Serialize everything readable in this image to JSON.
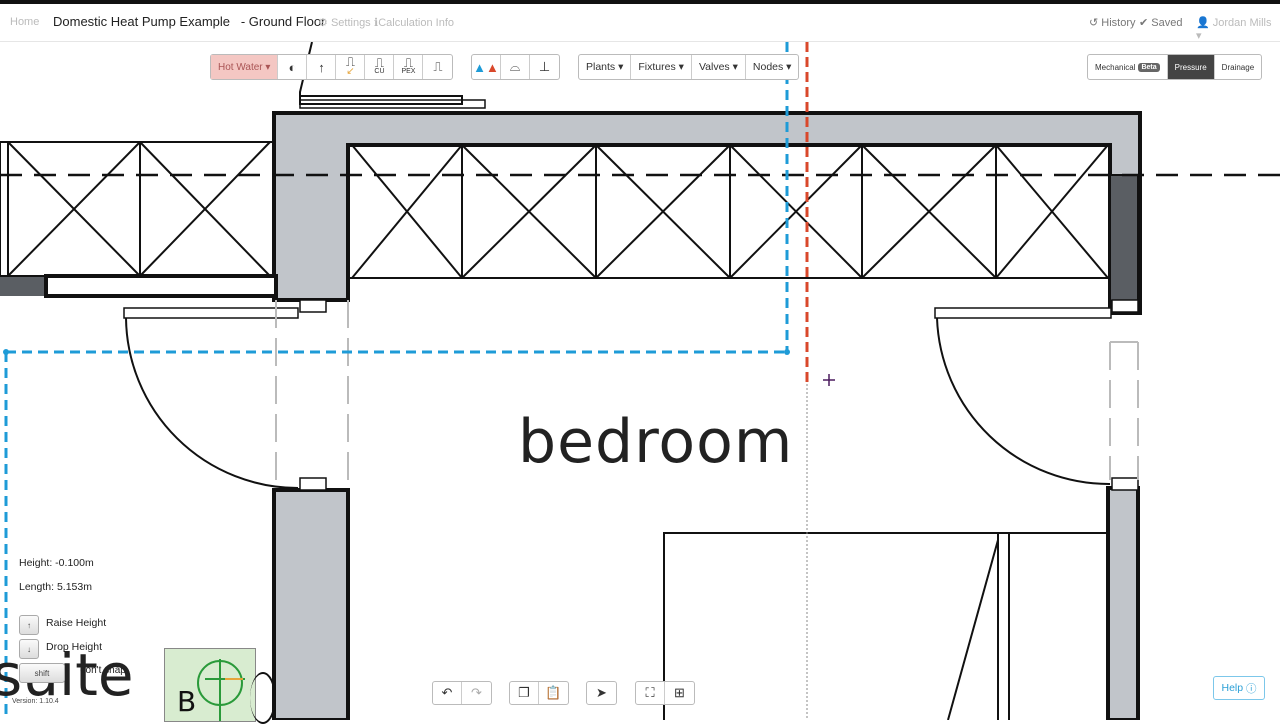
{
  "topbar": {
    "home": "Home",
    "project_title": "Domestic Heat Pump Example",
    "floor": "- Ground Floor",
    "settings": "Settings",
    "calculation_info": "Calculation Info",
    "history": "History",
    "saved": "Saved",
    "user": "Jordan Mills"
  },
  "toolbar": {
    "system": "Hot Water",
    "cu_label": "CU",
    "pex_label": "PEX",
    "menus": [
      "Plants",
      "Fixtures",
      "Valves",
      "Nodes"
    ]
  },
  "modes": {
    "mechanical": "Mechanical",
    "beta": "Beta",
    "pressure": "Pressure",
    "drainage": "Drainage"
  },
  "drawing": {
    "room_label": "bedroom",
    "suite_label": "suite",
    "mini_map_letter": "B"
  },
  "info": {
    "height": "Height: -0.100m",
    "length": "Length: 5.153m",
    "raise_height": "Raise Height",
    "drop_height": "Drop Height",
    "no_snap": "don't snap",
    "shift_key": "shift"
  },
  "help": "Help",
  "version": "Version: 1.10.4",
  "colors": {
    "accent_blue": "#1e9bd7",
    "pipe_red": "#d9482b",
    "hot_water_bg": "#f4c7c3",
    "wall_fill": "#c1c5ca"
  }
}
